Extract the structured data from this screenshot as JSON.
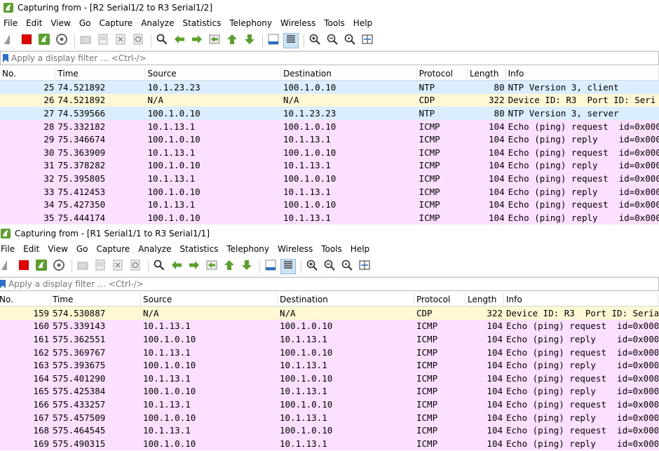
{
  "colors": {
    "ntp": "#daeeff",
    "cdp": "#fff8d5",
    "icmp": "#fce0ff",
    "accent": "#5aa02c"
  },
  "menu": [
    "File",
    "Edit",
    "View",
    "Go",
    "Capture",
    "Analyze",
    "Statistics",
    "Telephony",
    "Wireless",
    "Tools",
    "Help"
  ],
  "toolbar_icons": [
    "shark-fin-icon",
    "stop-icon",
    "restart-icon",
    "options-gear-icon",
    "open-folder-icon",
    "save-file-icon",
    "close-file-icon",
    "reload-icon",
    "find-icon",
    "back-arrow-icon",
    "forward-arrow-icon",
    "go-to-packet-icon",
    "first-packet-icon",
    "last-packet-icon",
    "autoscroll-icon",
    "colorize-icon",
    "zoom-in-icon",
    "zoom-out-icon",
    "normal-size-icon",
    "resize-columns-icon"
  ],
  "filter_placeholder": "Apply a display filter … <Ctrl-/>",
  "columns": [
    "No.",
    "Time",
    "Source",
    "Destination",
    "Protocol",
    "Length",
    "Info"
  ],
  "windows": [
    {
      "title": "Capturing from - [R2 Serial1/2 to R3 Serial1/2]",
      "packets": [
        {
          "no": "25",
          "time": "74.521892",
          "src": "10.1.23.23",
          "dst": "100.1.0.10",
          "proto": "NTP",
          "len": "80",
          "info": "NTP Version 3, client",
          "cls": "ntp"
        },
        {
          "no": "26",
          "time": "74.521892",
          "src": "N/A",
          "dst": "N/A",
          "proto": "CDP",
          "len": "322",
          "info": "Device ID: R3  Port ID: Seri",
          "cls": "cdp"
        },
        {
          "no": "27",
          "time": "74.539566",
          "src": "100.1.0.10",
          "dst": "10.1.23.23",
          "proto": "NTP",
          "len": "80",
          "info": "NTP Version 3, server",
          "cls": "ntp"
        },
        {
          "no": "28",
          "time": "75.332182",
          "src": "10.1.13.1",
          "dst": "100.1.0.10",
          "proto": "ICMP",
          "len": "104",
          "info": "Echo (ping) request  id=0x000",
          "cls": "icmp"
        },
        {
          "no": "29",
          "time": "75.346674",
          "src": "100.1.0.10",
          "dst": "10.1.13.1",
          "proto": "ICMP",
          "len": "104",
          "info": "Echo (ping) reply    id=0x000",
          "cls": "icmp"
        },
        {
          "no": "30",
          "time": "75.363909",
          "src": "10.1.13.1",
          "dst": "100.1.0.10",
          "proto": "ICMP",
          "len": "104",
          "info": "Echo (ping) request  id=0x000",
          "cls": "icmp"
        },
        {
          "no": "31",
          "time": "75.378282",
          "src": "100.1.0.10",
          "dst": "10.1.13.1",
          "proto": "ICMP",
          "len": "104",
          "info": "Echo (ping) reply    id=0x000",
          "cls": "icmp"
        },
        {
          "no": "32",
          "time": "75.395805",
          "src": "10.1.13.1",
          "dst": "100.1.0.10",
          "proto": "ICMP",
          "len": "104",
          "info": "Echo (ping) request  id=0x000",
          "cls": "icmp"
        },
        {
          "no": "33",
          "time": "75.412453",
          "src": "100.1.0.10",
          "dst": "10.1.13.1",
          "proto": "ICMP",
          "len": "104",
          "info": "Echo (ping) reply    id=0x000",
          "cls": "icmp"
        },
        {
          "no": "34",
          "time": "75.427350",
          "src": "10.1.13.1",
          "dst": "100.1.0.10",
          "proto": "ICMP",
          "len": "104",
          "info": "Echo (ping) request  id=0x000",
          "cls": "icmp"
        },
        {
          "no": "35",
          "time": "75.444174",
          "src": "100.1.0.10",
          "dst": "10.1.13.1",
          "proto": "ICMP",
          "len": "104",
          "info": "Echo (ping) reply    id=0x000",
          "cls": "icmp"
        }
      ]
    },
    {
      "title": "Capturing from - [R1 Serial1/1 to R3 Serial1/1]",
      "packets": [
        {
          "no": "159",
          "time": "574.530887",
          "src": "N/A",
          "dst": "N/A",
          "proto": "CDP",
          "len": "322",
          "info": "Device ID: R3  Port ID: Seria",
          "cls": "cdp"
        },
        {
          "no": "160",
          "time": "575.339143",
          "src": "10.1.13.1",
          "dst": "100.1.0.10",
          "proto": "ICMP",
          "len": "104",
          "info": "Echo (ping) request  id=0x000",
          "cls": "icmp"
        },
        {
          "no": "161",
          "time": "575.362551",
          "src": "100.1.0.10",
          "dst": "10.1.13.1",
          "proto": "ICMP",
          "len": "104",
          "info": "Echo (ping) reply    id=0x000",
          "cls": "icmp"
        },
        {
          "no": "162",
          "time": "575.369767",
          "src": "10.1.13.1",
          "dst": "100.1.0.10",
          "proto": "ICMP",
          "len": "104",
          "info": "Echo (ping) request  id=0x000",
          "cls": "icmp"
        },
        {
          "no": "163",
          "time": "575.393675",
          "src": "100.1.0.10",
          "dst": "10.1.13.1",
          "proto": "ICMP",
          "len": "104",
          "info": "Echo (ping) reply    id=0x000",
          "cls": "icmp"
        },
        {
          "no": "164",
          "time": "575.401290",
          "src": "10.1.13.1",
          "dst": "100.1.0.10",
          "proto": "ICMP",
          "len": "104",
          "info": "Echo (ping) request  id=0x000",
          "cls": "icmp"
        },
        {
          "no": "165",
          "time": "575.425384",
          "src": "100.1.0.10",
          "dst": "10.1.13.1",
          "proto": "ICMP",
          "len": "104",
          "info": "Echo (ping) reply    id=0x000",
          "cls": "icmp"
        },
        {
          "no": "166",
          "time": "575.433257",
          "src": "10.1.13.1",
          "dst": "100.1.0.10",
          "proto": "ICMP",
          "len": "104",
          "info": "Echo (ping) request  id=0x000",
          "cls": "icmp"
        },
        {
          "no": "167",
          "time": "575.457509",
          "src": "100.1.0.10",
          "dst": "10.1.13.1",
          "proto": "ICMP",
          "len": "104",
          "info": "Echo (ping) reply    id=0x000",
          "cls": "icmp"
        },
        {
          "no": "168",
          "time": "575.464545",
          "src": "10.1.13.1",
          "dst": "100.1.0.10",
          "proto": "ICMP",
          "len": "104",
          "info": "Echo (ping) request  id=0x000",
          "cls": "icmp"
        },
        {
          "no": "169",
          "time": "575.490315",
          "src": "100.1.0.10",
          "dst": "10.1.13.1",
          "proto": "ICMP",
          "len": "104",
          "info": "Echo (ping) reply    id=0x000",
          "cls": "icmp"
        }
      ]
    }
  ]
}
